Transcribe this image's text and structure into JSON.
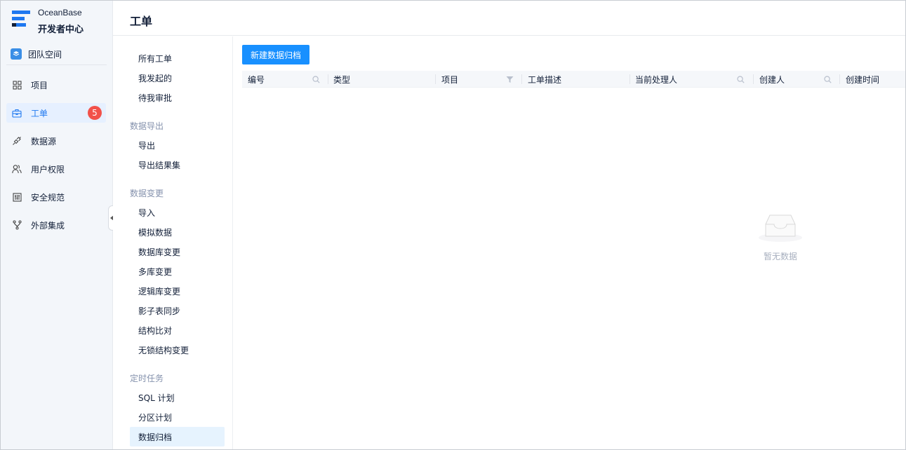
{
  "brand": {
    "name": "OceanBase",
    "subtitle": "开发者中心",
    "colors": {
      "primary": "#1890ff",
      "logo_dark": "#132039",
      "logo_blue": "#1e78f0"
    }
  },
  "team": {
    "label": "团队空间",
    "icon": "team-cube-icon"
  },
  "nav": {
    "items": [
      {
        "label": "项目",
        "icon": "grid-icon"
      },
      {
        "label": "工单",
        "icon": "briefcase-icon",
        "badge": "5",
        "active": true
      },
      {
        "label": "数据源",
        "icon": "plug-icon"
      },
      {
        "label": "用户权限",
        "icon": "users-icon"
      },
      {
        "label": "安全规范",
        "icon": "sliders-icon"
      },
      {
        "label": "外部集成",
        "icon": "fork-icon"
      }
    ]
  },
  "header": {
    "title": "工单"
  },
  "submenu": {
    "top_items": [
      "所有工单",
      "我发起的",
      "待我审批"
    ],
    "groups": [
      {
        "title": "数据导出",
        "items": [
          "导出",
          "导出结果集"
        ]
      },
      {
        "title": "数据变更",
        "items": [
          "导入",
          "模拟数据",
          "数据库变更",
          "多库变更",
          "逻辑库变更",
          "影子表同步",
          "结构比对",
          "无锁结构变更"
        ]
      },
      {
        "title": "定时任务",
        "items": [
          "SQL 计划",
          "分区计划",
          "数据归档"
        ]
      }
    ],
    "active": "数据归档"
  },
  "main": {
    "new_button": "新建数据归档",
    "columns": [
      {
        "label": "编号",
        "icon": "search-icon"
      },
      {
        "label": "类型",
        "icon": ""
      },
      {
        "label": "项目",
        "icon": "filter-icon"
      },
      {
        "label": "工单描述",
        "icon": ""
      },
      {
        "label": "当前处理人",
        "icon": "search-icon"
      },
      {
        "label": "创建人",
        "icon": "search-icon"
      },
      {
        "label": "创建时间",
        "icon": ""
      }
    ],
    "empty_text": "暂无数据",
    "empty_icon": "empty-inbox-icon"
  }
}
